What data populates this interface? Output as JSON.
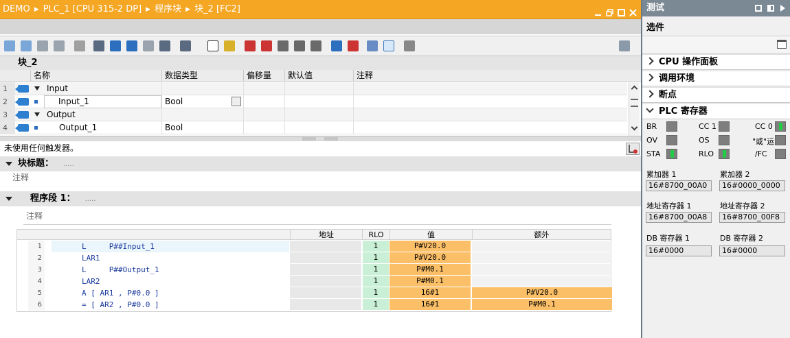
{
  "editor": {
    "breadcrumb": [
      "DEMO",
      "PLC_1 [CPU 315-2 DP]",
      "程序块",
      "块_2 [FC2]"
    ],
    "block_name": "块_2",
    "interface_headers": [
      "名称",
      "数据类型",
      "偏移量",
      "默认值",
      "注释"
    ],
    "interface_rows": [
      {
        "num": "1",
        "name": "Input",
        "type": "",
        "expandable": true
      },
      {
        "num": "2",
        "name": "Input_1",
        "type": "Bool",
        "expandable": false
      },
      {
        "num": "3",
        "name": "Output",
        "type": "",
        "expandable": true
      },
      {
        "num": "4",
        "name": "Output_1",
        "type": "Bool",
        "expandable": false
      }
    ],
    "trigger_text": "未使用任何触发器。",
    "block_title_label": "块标题：",
    "block_title_dots": ".....",
    "comment_label": "注释",
    "network_label": "程序段 1：",
    "network_dots": ".....",
    "network_comment": "注释",
    "code_headers": {
      "addr": "地址",
      "rlo": "RLO",
      "value": "值",
      "extra": "额外"
    },
    "code_rows": [
      {
        "num": "1",
        "code": "L     P##Input_1",
        "rlo": "1",
        "value": "P#V20.0",
        "extra": ""
      },
      {
        "num": "2",
        "code": "LAR1",
        "rlo": "1",
        "value": "P#V20.0",
        "extra": ""
      },
      {
        "num": "3",
        "code": "L     P##Output_1",
        "rlo": "1",
        "value": "P#M0.1",
        "extra": ""
      },
      {
        "num": "4",
        "code": "LAR2",
        "rlo": "1",
        "value": "P#M0.1",
        "extra": ""
      },
      {
        "num": "5",
        "code": "A [ AR1 , P#0.0 ]",
        "rlo": "1",
        "value": "16#1",
        "extra": "P#V20.0"
      },
      {
        "num": "6",
        "code": "= [ AR2 , P#0.0 ]",
        "rlo": "1",
        "value": "16#1",
        "extra": "P#M0.1"
      }
    ]
  },
  "right_panel": {
    "title": "测试",
    "subtitle": "选件",
    "panes": [
      "CPU 操作面板",
      "调用环境",
      "断点",
      "PLC 寄存器"
    ],
    "registers": [
      {
        "label": "BR",
        "on": false
      },
      {
        "label": "CC 1",
        "on": false
      },
      {
        "label": "CC 0",
        "on": true
      },
      {
        "label": "OV",
        "on": false
      },
      {
        "label": "OS",
        "on": false
      },
      {
        "label": "\"或\"运",
        "on": false
      },
      {
        "label": "STA",
        "on": true
      },
      {
        "label": "RLO",
        "on": true
      },
      {
        "label": "/FC",
        "on": false
      }
    ],
    "accumulators": [
      {
        "label": "累加器 1",
        "value": "16#8700_00A0"
      },
      {
        "label": "累加器 2",
        "value": "16#0000_0000"
      },
      {
        "label": "地址寄存器 1",
        "value": "16#8700_00A8"
      },
      {
        "label": "地址寄存器 2",
        "value": "16#8700_00F8"
      },
      {
        "label": "DB 寄存器 1",
        "value": "16#0000"
      },
      {
        "label": "DB 寄存器 2",
        "value": "16#0000"
      }
    ]
  },
  "colors": {
    "title_orange": "#f5a623",
    "panel_gray": "#7b8994",
    "value_orange": "#fbbf68",
    "rlo_green": "#c9f0d6"
  }
}
